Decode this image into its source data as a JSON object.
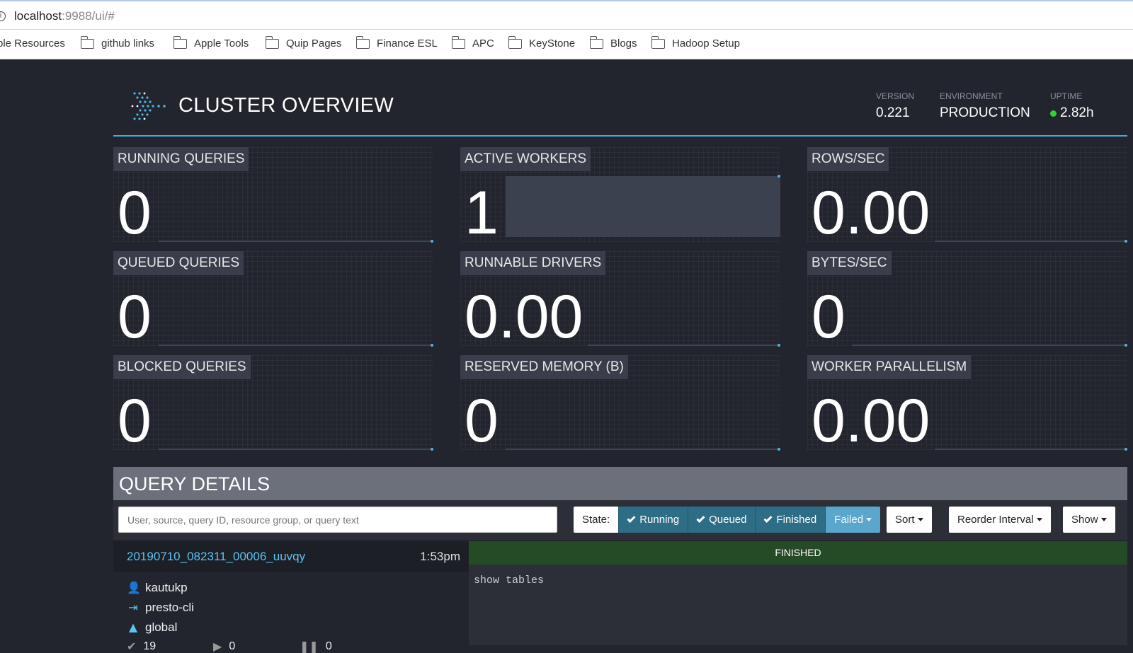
{
  "browser": {
    "url_host": "localhost",
    "url_rest": ":9988/ui/#",
    "bookmarks": [
      "ple Resources",
      "github links",
      "Apple Tools",
      "Quip Pages",
      "Finance ESL",
      "APC",
      "KeyStone",
      "Blogs",
      "Hadoop Setup"
    ]
  },
  "header": {
    "title": "CLUSTER OVERVIEW",
    "version_label": "VERSION",
    "version": "0.221",
    "environment_label": "ENVIRONMENT",
    "environment": "PRODUCTION",
    "uptime_label": "UPTIME",
    "uptime": "2.82h"
  },
  "stats": [
    {
      "label": "RUNNING QUERIES",
      "value": "0"
    },
    {
      "label": "ACTIVE WORKERS",
      "value": "1"
    },
    {
      "label": "ROWS/SEC",
      "value": "0.00"
    },
    {
      "label": "QUEUED QUERIES",
      "value": "0"
    },
    {
      "label": "RUNNABLE DRIVERS",
      "value": "0.00"
    },
    {
      "label": "BYTES/SEC",
      "value": "0"
    },
    {
      "label": "BLOCKED QUERIES",
      "value": "0"
    },
    {
      "label": "RESERVED MEMORY (B)",
      "value": "0"
    },
    {
      "label": "WORKER PARALLELISM",
      "value": "0.00"
    }
  ],
  "query_details": {
    "title": "QUERY DETAILS",
    "search_placeholder": "User, source, query ID, resource group, or query text",
    "state_label": "State:",
    "filters": {
      "running": "Running",
      "queued": "Queued",
      "finished": "Finished",
      "failed": "Failed"
    },
    "sort_label": "Sort",
    "reorder_label": "Reorder Interval",
    "show_label": "Show"
  },
  "query": {
    "id": "20190710_082311_00006_uuvqy",
    "time": "1:53pm",
    "state": "FINISHED",
    "user": "kautukp",
    "source": "presto-cli",
    "resource_group": "global",
    "completed_splits": "19",
    "running_splits": "0",
    "queued_splits": "0",
    "text": "show tables"
  },
  "colors": {
    "accent": "#46aadc",
    "link": "#5cc4f0",
    "finished": "#254a26",
    "uptime_dot": "#2bd52b"
  }
}
